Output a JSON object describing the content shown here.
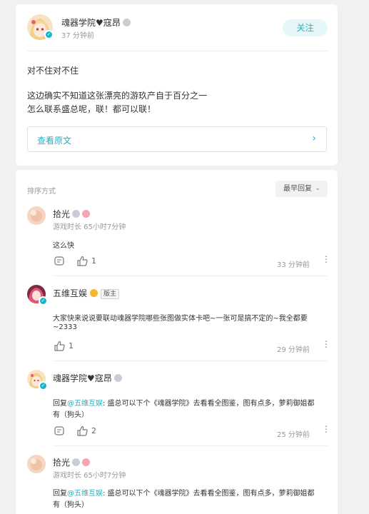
{
  "post": {
    "author": "魂器学院♥寇昂",
    "time": "37 分钟前",
    "follow_label": "关注",
    "lines": [
      "对不住对不住",
      "",
      "这边确实不知道这张漂亮的游玖产自于百分之一",
      "怎么联系盛总呢，联！都可以联！"
    ],
    "original_link": "查看原文",
    "chevron": "›"
  },
  "comments_section": {
    "sort_label": "排序方式",
    "sort_value": "最早回复",
    "sort_chevron": "⌄",
    "comments": [
      {
        "name": "拾光",
        "playtime": "游戏时长 65小时7分钟",
        "text": [
          "这么快"
        ],
        "likes": "1",
        "time": "33 分钟前",
        "more": "•\n•\n•"
      },
      {
        "name": "五维互娱",
        "badge": "版主",
        "text": [
          "大家快来说说要联动魂器学院哪些张图做实体卡吧~一张可是搞不定的~我全都要",
          "~2333"
        ],
        "likes": "1",
        "time": "29 分钟前",
        "more": "•\n•\n•"
      },
      {
        "name": "魂器学院♥寇昂",
        "reply_prefix": "回复",
        "mention": "@五维互娱",
        "reply_rest": ": 盛总可以下个《魂器学院》去看看全图鉴，图有点多，萝莉御姐都",
        "text2": "有（狗头）",
        "likes": "2",
        "time": "25 分钟前",
        "more": "•\n•\n•"
      },
      {
        "name": "拾光",
        "playtime": "游戏时长 65小时7分钟",
        "reply_prefix": "回复",
        "mention": "@五维互娱",
        "reply_rest": ": 盛总可以下个《魂器学院》去看看全图鉴，图有点多，萝莉御姐都",
        "text2": "有（狗头）"
      }
    ]
  },
  "colors": {
    "accent": "#19b5c6",
    "bg": "#f0f1f3"
  }
}
